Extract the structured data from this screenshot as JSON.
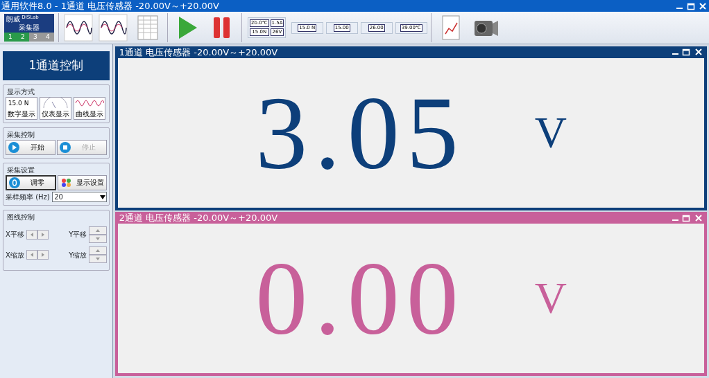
{
  "window": {
    "title": "通用软件8.0 - 1通道 电压传感器 -20.00V～+20.00V"
  },
  "toolbar": [
    {
      "kind": "collector",
      "brand": "朗威",
      "sub": "DISLab",
      "label": "采集器",
      "channels": [
        {
          "label": "1",
          "selected": true
        },
        {
          "label": "2",
          "selected": true
        },
        {
          "label": "3",
          "selected": false
        },
        {
          "label": "4",
          "selected": false
        }
      ]
    },
    {
      "kind": "wave"
    },
    {
      "kind": "wave"
    },
    {
      "kind": "table"
    },
    {
      "kind": "play"
    },
    {
      "kind": "pause"
    },
    {
      "kind": "multi",
      "texts": [
        "2b.0℃",
        "1.5A",
        "15.0N",
        "26V"
      ]
    },
    {
      "kind": "digital",
      "texts": [
        "15.0 N"
      ]
    },
    {
      "kind": "camera",
      "texts": [
        "15.00"
      ]
    },
    {
      "kind": "transfer",
      "texts": [
        "26.00"
      ]
    },
    {
      "kind": "temperature",
      "texts": [
        "39.00℃"
      ]
    },
    {
      "kind": "report"
    },
    {
      "kind": "camcorder"
    }
  ],
  "control_panel": {
    "title": "1通道控制",
    "display_mode": {
      "title": "显示方式",
      "modes": [
        {
          "kind": "digital",
          "label": "数字显示",
          "preview": "15.0 N"
        },
        {
          "kind": "meter",
          "label": "仪表显示"
        },
        {
          "kind": "curve",
          "label": "曲线显示"
        }
      ]
    },
    "acquisition_control": {
      "title": "采集控制",
      "buttons": [
        {
          "kind": "start",
          "label": "开始",
          "disabled": false
        },
        {
          "kind": "stop",
          "label": "停止",
          "disabled": true
        }
      ]
    },
    "acquisition_settings": {
      "title": "采集设置",
      "buttons": [
        {
          "kind": "zero",
          "label": "调零",
          "selected": true
        },
        {
          "kind": "display",
          "label": "显示设置",
          "selected": false
        }
      ],
      "rate_label": "采样频率 (Hz)",
      "rate_value": "20"
    },
    "curve_control": {
      "title": "图线控制",
      "rows": [
        {
          "x_label": "X平移",
          "y_label": "Y平移"
        },
        {
          "x_label": "X缩放",
          "y_label": "Y缩放"
        }
      ]
    }
  },
  "channels": [
    {
      "title": "1通道 电压传感器 -20.00V～+20.00V",
      "value": "3.05",
      "unit": "V",
      "color": "#0d3f7a"
    },
    {
      "title": "2通道 电压传感器 -20.00V～+20.00V",
      "value": "0.00",
      "unit": "V",
      "color": "#c8609a"
    }
  ]
}
